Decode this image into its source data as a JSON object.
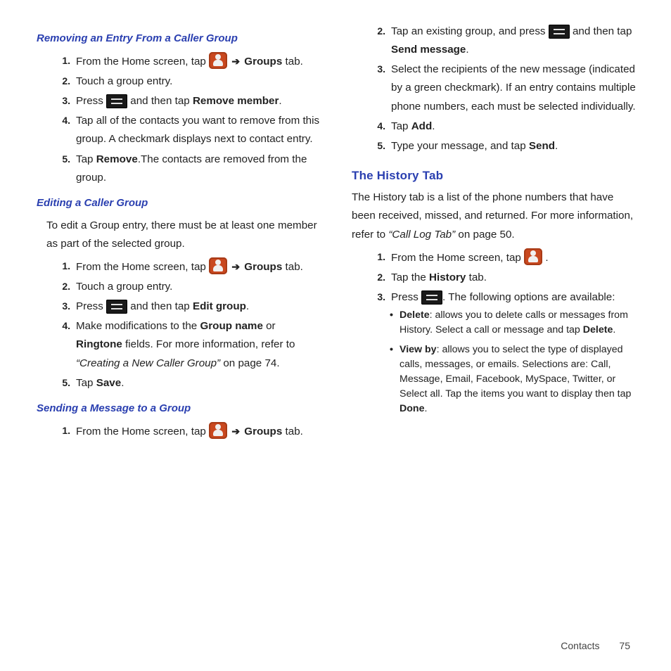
{
  "left": {
    "removing": {
      "title": "Removing an Entry From a Caller Group",
      "s1a": "From the Home screen, tap ",
      "s1_groups": "Groups",
      "s1b": " tab.",
      "s2": "Touch a group entry.",
      "s3a": "Press ",
      "s3b": " and then tap ",
      "s3_bold": "Remove member",
      "s3c": ".",
      "s4": "Tap all of the contacts you want to remove from this group. A checkmark displays next to contact entry.",
      "s5a": "Tap ",
      "s5_bold": "Remove",
      "s5b": ".The contacts are removed from the group."
    },
    "editing": {
      "title": "Editing a Caller Group",
      "intro": "To edit a Group entry, there must be at least one member as part of the selected group.",
      "s1a": "From the Home screen, tap ",
      "s1_groups": "Groups",
      "s1b": " tab.",
      "s2": "Touch a group entry.",
      "s3a": "Press ",
      "s3b": " and then tap ",
      "s3_bold": "Edit group",
      "s3c": ".",
      "s4a": "Make modifications to the ",
      "s4_b1": "Group name",
      "s4b": " or ",
      "s4_b2": "Ringtone",
      "s4c": " fields. For more information, refer to ",
      "s4_ital": "“Creating a New Caller Group” ",
      "s4d": " on page 74.",
      "s5a": "Tap ",
      "s5_bold": "Save",
      "s5b": "."
    },
    "sending": {
      "title": "Sending a Message to a Group",
      "s1a": "From the Home screen, tap ",
      "s1_groups": "Groups",
      "s1b": " tab."
    }
  },
  "right": {
    "cont": {
      "s2a": "Tap an existing group, and press ",
      "s2b": " and then tap ",
      "s2_bold": "Send message",
      "s2c": ".",
      "s3": "Select the recipients of the new message (indicated by a green checkmark). If an entry contains multiple phone numbers, each must be selected individually.",
      "s4a": "Tap ",
      "s4_bold": "Add",
      "s4b": ".",
      "s5a": "Type your message, and tap ",
      "s5_bold": "Send",
      "s5b": "."
    },
    "history": {
      "title": "The History Tab",
      "intro_a": "The History tab is a list of the phone numbers that have been received, missed, and returned. For more information, refer to ",
      "intro_ital": "“Call Log Tab” ",
      "intro_b": " on page 50.",
      "s1a": "From the Home screen, tap ",
      "s1b": ".",
      "s2a": "Tap the ",
      "s2_bold": "History",
      "s2b": " tab.",
      "s3a": "Press ",
      "s3b": ". The following options are available:",
      "b1_a": "Delete",
      "b1_b": ": allows you to delete calls or messages from History. Select a call or message and tap ",
      "b1_c": "Delete",
      "b1_d": ".",
      "b2_a": "View by",
      "b2_b": ": allows you to select the type of displayed calls, messages, or emails. Selections are: Call, Message, Email, Facebook, MySpace, Twitter, or Select all. Tap the items you want to display then tap ",
      "b2_c": "Done",
      "b2_d": "."
    }
  },
  "arrow": "➔",
  "footer": {
    "section": "Contacts",
    "page": "75"
  }
}
